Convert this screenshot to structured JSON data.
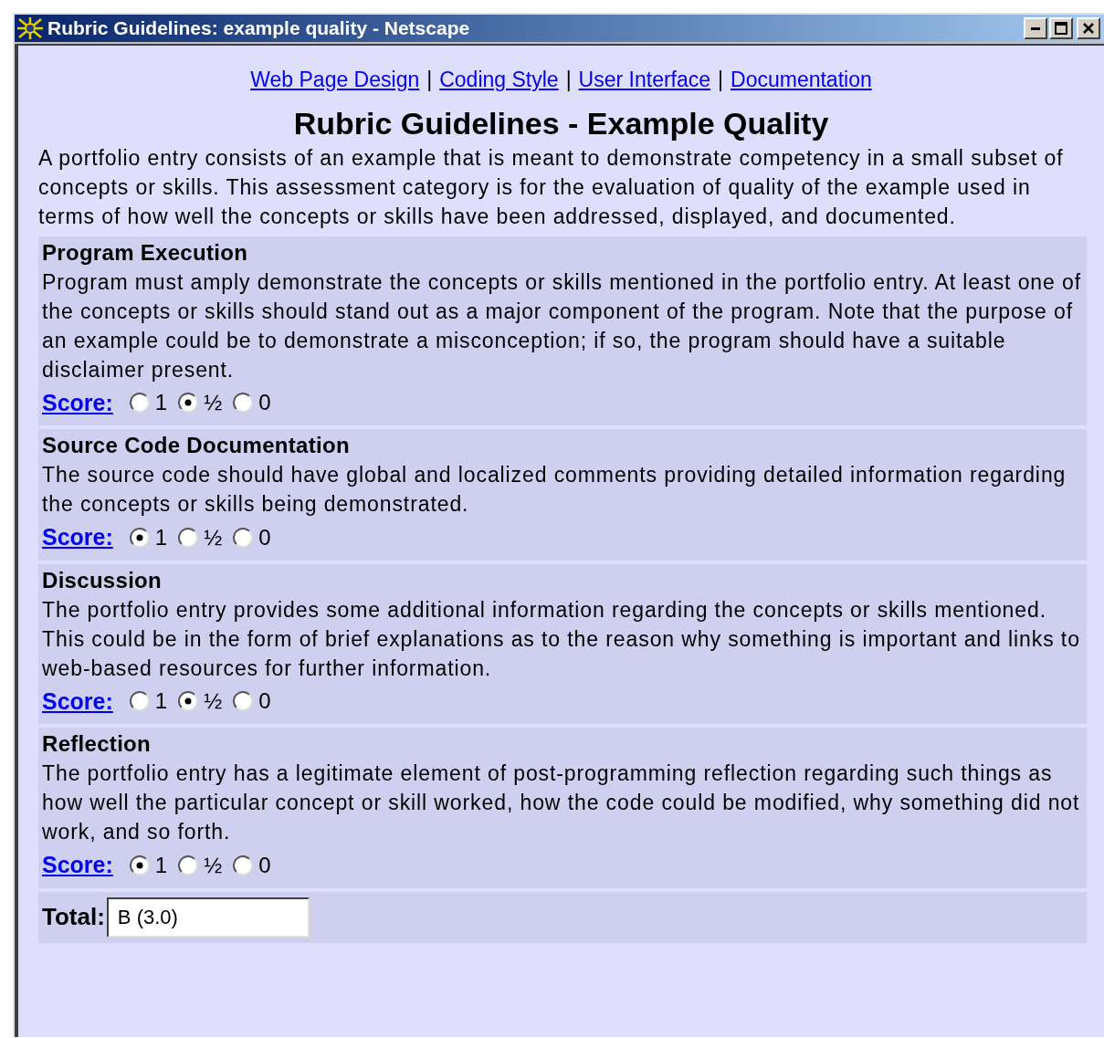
{
  "window": {
    "title": "Rubric Guidelines: example quality - Netscape"
  },
  "nav_links": [
    {
      "label": "Web Page Design"
    },
    {
      "label": "Coding Style"
    },
    {
      "label": "User Interface"
    },
    {
      "label": "Documentation"
    }
  ],
  "nav_separator": "|",
  "heading": "Rubric Guidelines - Example Quality",
  "intro": "A portfolio entry consists of an example that is meant to demonstrate competency in a small subset of concepts or skills. This assessment category is for the evaluation of quality of the example used in terms of how well the concepts or skills have been addressed, displayed, and documented.",
  "criteria": [
    {
      "title": "Program Execution",
      "description": "Program must amply demonstrate the concepts or skills mentioned in the portfolio entry. At least one of the concepts or skills should stand out as a major component of the program. Note that the purpose of an example could be to demonstrate a misconception; if so, the program should have a suitable disclaimer present.",
      "score_label": "Score:",
      "options": [
        {
          "label": "1",
          "selected": false
        },
        {
          "label": "½",
          "selected": true
        },
        {
          "label": "0",
          "selected": false
        }
      ]
    },
    {
      "title": "Source Code Documentation",
      "description": "The source code should have global and localized comments providing detailed information regarding the concepts or skills being demonstrated.",
      "score_label": "Score:",
      "options": [
        {
          "label": "1",
          "selected": true
        },
        {
          "label": "½",
          "selected": false
        },
        {
          "label": "0",
          "selected": false
        }
      ]
    },
    {
      "title": "Discussion",
      "description": "The portfolio entry provides some additional information regarding the concepts or skills mentioned. This could be in the form of brief explanations as to the reason why something is important and links to web-based resources for further information.",
      "score_label": "Score:",
      "options": [
        {
          "label": "1",
          "selected": false
        },
        {
          "label": "½",
          "selected": true
        },
        {
          "label": "0",
          "selected": false
        }
      ]
    },
    {
      "title": "Reflection",
      "description": "The portfolio entry has a legitimate element of post-programming reflection regarding such things as how well the particular concept or skill worked, how the code could be modified, why something did not work, and so forth.",
      "score_label": "Score:",
      "options": [
        {
          "label": "1",
          "selected": true
        },
        {
          "label": "½",
          "selected": false
        },
        {
          "label": "0",
          "selected": false
        }
      ]
    }
  ],
  "total": {
    "label": "Total:",
    "value": "B (3.0)"
  }
}
